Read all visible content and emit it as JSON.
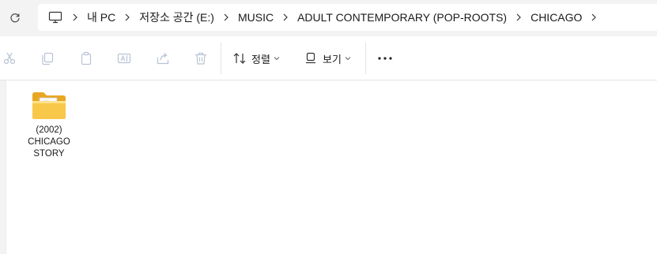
{
  "address_bar": {
    "crumbs": [
      "내 PC",
      "저장소 공간 (E:)",
      "MUSIC",
      "ADULT CONTEMPORARY (POP-ROOTS)",
      "CHICAGO"
    ]
  },
  "toolbar": {
    "sort_label": "정렬",
    "view_label": "보기"
  },
  "files": [
    {
      "name": "(2002)\nCHICAGO\nSTORY",
      "type": "folder"
    }
  ],
  "colors": {
    "folder_yellow": "#f8c84a",
    "folder_light": "#ffe28a",
    "disabled_icon": "#b8c4d4",
    "accent": "#1a1a1a"
  }
}
